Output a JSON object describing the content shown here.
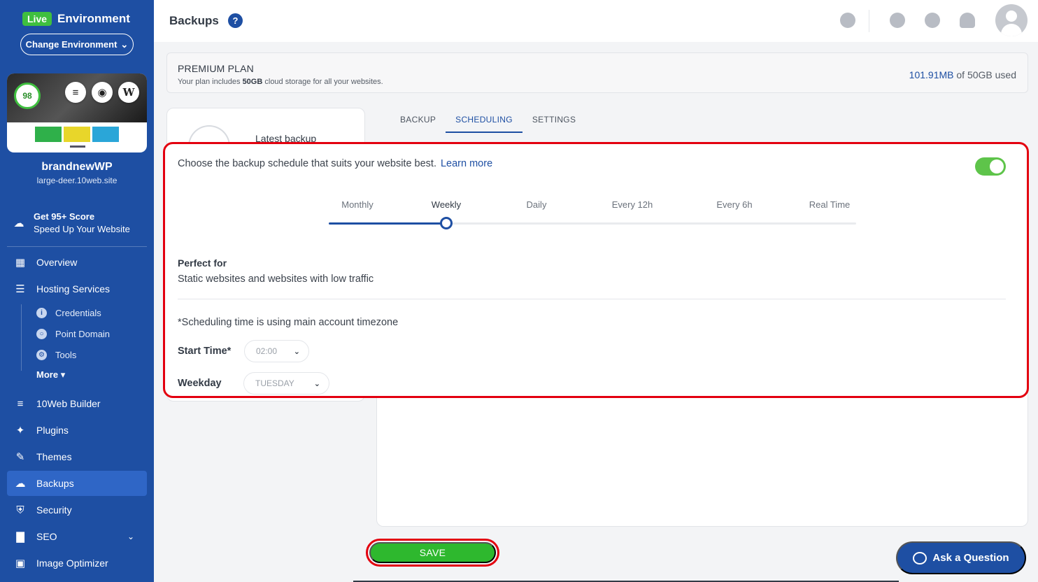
{
  "sidebar": {
    "live_badge": "Live",
    "env_title": "Environment",
    "change_env_label": "Change Environment",
    "score": "98",
    "site_name": "brandnewWP",
    "site_domain": "large-deer.10web.site",
    "promo_title": "Get 95+ Score",
    "promo_sub": "Speed Up Your Website",
    "nav": {
      "overview": "Overview",
      "hosting": "Hosting Services",
      "credentials": "Credentials",
      "point_domain": "Point Domain",
      "tools": "Tools",
      "more": "More",
      "builder": "10Web Builder",
      "plugins": "Plugins",
      "themes": "Themes",
      "backups": "Backups",
      "security": "Security",
      "seo": "SEO",
      "image_optimizer": "Image Optimizer"
    }
  },
  "header": {
    "title": "Backups",
    "help": "?"
  },
  "plan": {
    "name": "PREMIUM PLAN",
    "desc_prefix": "Your plan includes ",
    "desc_storage": "50GB",
    "desc_suffix": " cloud storage for all your websites.",
    "used": "101.91MB",
    "of_total": " of 50GB used"
  },
  "latest_backup_label": "Latest backup",
  "tabs": {
    "backup": "BACKUP",
    "scheduling": "SCHEDULING",
    "settings": "SETTINGS"
  },
  "scheduling": {
    "intro": "Choose the backup schedule that suits your website best.",
    "learn_more": "Learn more",
    "enabled": true,
    "frequencies": [
      "Monthly",
      "Weekly",
      "Daily",
      "Every 12h",
      "Every 6h",
      "Real Time"
    ],
    "selected_index": 1,
    "perfect_for_title": "Perfect for",
    "perfect_for_desc": "Static websites and websites with low traffic",
    "timezone_note": "*Scheduling time is using main account timezone",
    "start_time_label": "Start Time*",
    "start_time_value": "02:00",
    "weekday_label": "Weekday",
    "weekday_value": "TUESDAY"
  },
  "save_label": "SAVE",
  "ask_label": "Ask a Question",
  "colors": {
    "sidebar_bg": "#1e4fa3",
    "accent": "#1e4fa3",
    "success": "#2eb82e",
    "highlight": "#e3000f"
  }
}
